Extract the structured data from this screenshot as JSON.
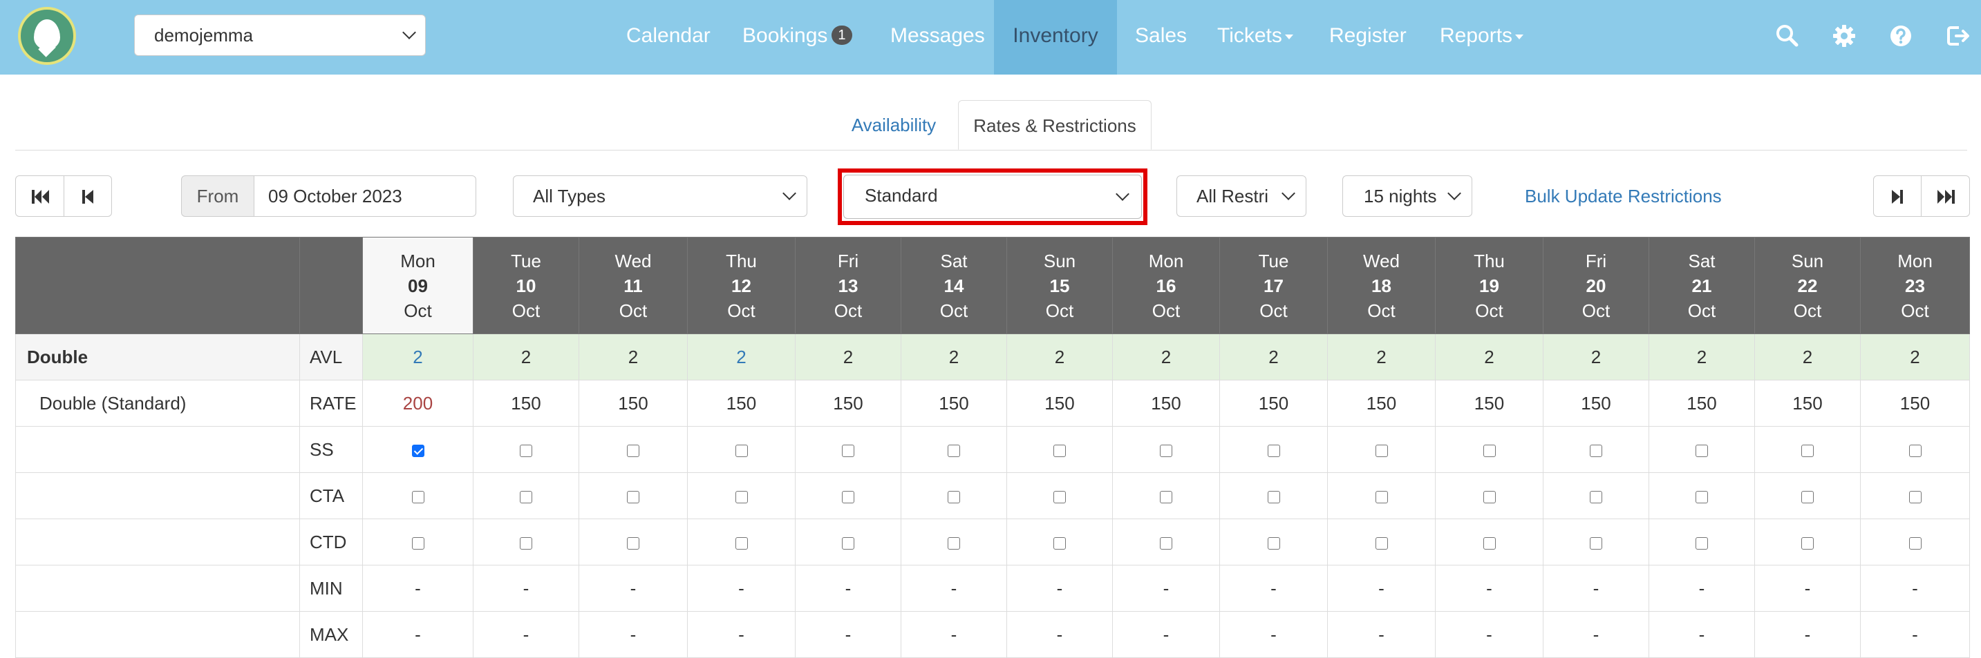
{
  "nav": {
    "property": "demojemma",
    "items": [
      {
        "label": "Calendar"
      },
      {
        "label": "Bookings",
        "badge": "1"
      },
      {
        "label": "Messages"
      },
      {
        "label": "Inventory",
        "active": true
      },
      {
        "label": "Sales"
      },
      {
        "label": "Tickets",
        "dropdown": true
      },
      {
        "label": "Register"
      },
      {
        "label": "Reports",
        "dropdown": true
      }
    ],
    "icons": [
      "search-icon",
      "gear-icon",
      "help-icon",
      "logout-icon"
    ]
  },
  "tabs": {
    "availability": "Availability",
    "rates": "Rates & Restrictions",
    "active": "rates"
  },
  "toolbar": {
    "from_label": "From",
    "from_date": "09 October 2023",
    "type_filter": "All Types",
    "rate_plan": "Standard",
    "restriction_filter": "All Restri",
    "nights": "15 nights",
    "bulk_link": "Bulk Update Restrictions"
  },
  "grid": {
    "days": [
      {
        "dow": "Mon",
        "day": "09",
        "month": "Oct",
        "today": true
      },
      {
        "dow": "Tue",
        "day": "10",
        "month": "Oct"
      },
      {
        "dow": "Wed",
        "day": "11",
        "month": "Oct"
      },
      {
        "dow": "Thu",
        "day": "12",
        "month": "Oct"
      },
      {
        "dow": "Fri",
        "day": "13",
        "month": "Oct"
      },
      {
        "dow": "Sat",
        "day": "14",
        "month": "Oct"
      },
      {
        "dow": "Sun",
        "day": "15",
        "month": "Oct"
      },
      {
        "dow": "Mon",
        "day": "16",
        "month": "Oct"
      },
      {
        "dow": "Tue",
        "day": "17",
        "month": "Oct"
      },
      {
        "dow": "Wed",
        "day": "18",
        "month": "Oct"
      },
      {
        "dow": "Thu",
        "day": "19",
        "month": "Oct"
      },
      {
        "dow": "Fri",
        "day": "20",
        "month": "Oct"
      },
      {
        "dow": "Sat",
        "day": "21",
        "month": "Oct"
      },
      {
        "dow": "Sun",
        "day": "22",
        "month": "Oct"
      },
      {
        "dow": "Mon",
        "day": "23",
        "month": "Oct"
      }
    ],
    "room_type": "Double",
    "rate_name": "Double (Standard)",
    "rows": [
      {
        "label": "AVL",
        "kind": "avl",
        "values": [
          "2",
          "2",
          "2",
          "2",
          "2",
          "2",
          "2",
          "2",
          "2",
          "2",
          "2",
          "2",
          "2",
          "2",
          "2"
        ],
        "links": [
          0,
          3
        ]
      },
      {
        "label": "RATE",
        "kind": "rate",
        "values": [
          "200",
          "150",
          "150",
          "150",
          "150",
          "150",
          "150",
          "150",
          "150",
          "150",
          "150",
          "150",
          "150",
          "150",
          "150"
        ],
        "changed": [
          0
        ]
      },
      {
        "label": "SS",
        "kind": "check",
        "values": [
          true,
          false,
          false,
          false,
          false,
          false,
          false,
          false,
          false,
          false,
          false,
          false,
          false,
          false,
          false
        ]
      },
      {
        "label": "CTA",
        "kind": "check",
        "values": [
          false,
          false,
          false,
          false,
          false,
          false,
          false,
          false,
          false,
          false,
          false,
          false,
          false,
          false,
          false
        ]
      },
      {
        "label": "CTD",
        "kind": "check",
        "values": [
          false,
          false,
          false,
          false,
          false,
          false,
          false,
          false,
          false,
          false,
          false,
          false,
          false,
          false,
          false
        ]
      },
      {
        "label": "MIN",
        "kind": "text",
        "values": [
          "-",
          "-",
          "-",
          "-",
          "-",
          "-",
          "-",
          "-",
          "-",
          "-",
          "-",
          "-",
          "-",
          "-",
          "-"
        ]
      },
      {
        "label": "MAX",
        "kind": "text",
        "values": [
          "-",
          "-",
          "-",
          "-",
          "-",
          "-",
          "-",
          "-",
          "-",
          "-",
          "-",
          "-",
          "-",
          "-",
          "-"
        ]
      }
    ]
  }
}
